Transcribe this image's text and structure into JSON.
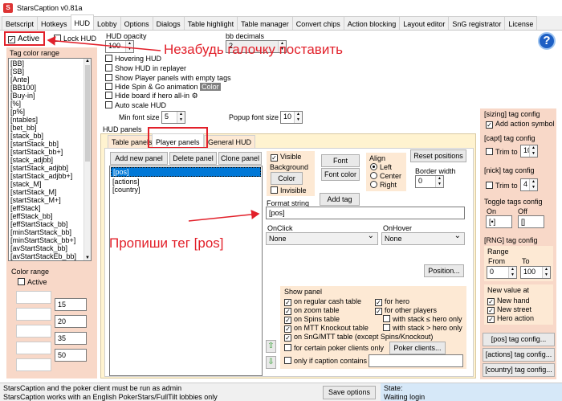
{
  "title": "StarsCaption v0.81a",
  "tabs": [
    "Betscript",
    "Hotkeys",
    "HUD",
    "Lobby",
    "Options",
    "Dialogs",
    "Table highlight",
    "Table manager",
    "Convert chips",
    "Action blocking",
    "Layout editor",
    "SnG registrator",
    "License"
  ],
  "left": {
    "active_label": "Active",
    "lock_label": "Lock HUD",
    "tag_color_range": "Tag color range",
    "tags": [
      "[BB]",
      "[SB]",
      "[Ante]",
      "[BB100]",
      "[Buy-in]",
      "[%]",
      "[p%]",
      "[ntables]",
      "[bet_bb]",
      "[stack_bb]",
      "[startStack_bb]",
      "[startStack_bb+]",
      "[stack_adjbb]",
      "[startStack_adjbb]",
      "[startStack_adjbb+]",
      "[stack_M]",
      "[startStack_M]",
      "[startStack_M+]",
      "[effStack]",
      "[effStack_bb]",
      "[effStartStack_bb]",
      "[minStartStack_bb]",
      "[minStartStack_bb+]",
      "[avStartStack_bb]",
      "[avStartStackEb_bb]"
    ],
    "color_range": "Color range",
    "color_active": "Active",
    "color_values": [
      "15",
      "20",
      "35",
      "50"
    ]
  },
  "hud_opacity": {
    "label": "HUD opacity",
    "value": "100"
  },
  "bb_decimals": {
    "label": "bb decimals",
    "value": "2"
  },
  "options": [
    "Hovering HUD",
    "Show HUD in replayer",
    "Show Player panels with empty tags",
    "Hide Spin & Go animation",
    "Hide board if hero all-in",
    "Auto scale HUD"
  ],
  "color_chip": "Color",
  "min_font": {
    "label": "Min font size",
    "value": "5"
  },
  "popup_font": {
    "label": "Popup font size",
    "value": "10"
  },
  "hud_panels": "HUD panels",
  "subtabs": [
    "Table panels",
    "Player panels",
    "General HUD"
  ],
  "panel_buttons": [
    "Add new panel",
    "Delete panel",
    "Clone panel"
  ],
  "panel_list": [
    "[pos]",
    "[actions]",
    "[country]"
  ],
  "visible": "Visible",
  "background": "Background",
  "color_btn": "Color",
  "invisible": "Invisible",
  "font_btn": "Font",
  "font_color_btn": "Font color",
  "add_tag": "Add tag",
  "align": {
    "label": "Align",
    "options": [
      "Left",
      "Center",
      "Right"
    ]
  },
  "reset_positions": "Reset positions",
  "border_width": {
    "label": "Border width",
    "value": "0"
  },
  "format_string": {
    "label": "Format string",
    "value": "[pos]"
  },
  "onclick": {
    "label": "OnClick",
    "value": "None"
  },
  "onhover": {
    "label": "OnHover",
    "value": "None"
  },
  "position_btn": "Position...",
  "show_panel": {
    "label": "Show panel",
    "left": [
      "on regular cash table",
      "on zoom table",
      "on Spins table",
      "on MTT Knockout table",
      "on SnG/MTT table (except Spins/Knockout)",
      "for certain poker clients only",
      "only if caption contains"
    ],
    "right": [
      "for hero",
      "for other players",
      "with stack ≤ hero only",
      "with stack > hero only"
    ],
    "poker_clients": "Poker clients..."
  },
  "right": {
    "sizing": "[sizing] tag config",
    "add_action": "Add action symbol",
    "capt": "[capt] tag config",
    "trim": "Trim to",
    "capt_val": "10",
    "nick": "[nick] tag config",
    "nick_val": "4",
    "toggle": "Toggle tags config",
    "on": "On",
    "off": "Off",
    "on_val": "[•]",
    "off_val": "[]",
    "rng": "[RNG] tag config",
    "range": "Range",
    "from": "From",
    "to": "To",
    "from_val": "0",
    "to_val": "100",
    "newval": "New value at",
    "newval_items": [
      "New hand",
      "New street",
      "Hero action"
    ],
    "cfg_buttons": [
      "[pos] tag config...",
      "[actions] tag config...",
      "[country] tag config..."
    ]
  },
  "status": {
    "line1": "StarsCaption and the poker client must be run as admin",
    "line2": "StarsCaption works with an English PokerStars/FullTilt lobbies only",
    "save": "Save options",
    "state_label": "State:",
    "state_value": "Waiting login"
  },
  "annotations": {
    "top": "Незабудь галочку поставить",
    "mid": "Пропиши тег [pos]"
  },
  "colors": {
    "annotation": "#e2202a",
    "selected": "#0078d7"
  }
}
